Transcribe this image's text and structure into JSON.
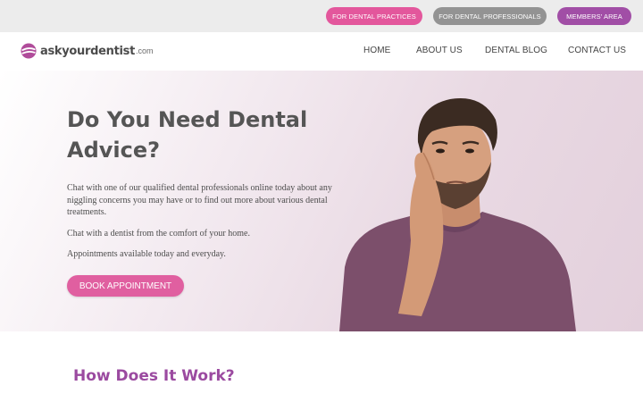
{
  "topbar": {
    "buttons": [
      {
        "label": "FOR DENTAL PRACTICES",
        "color": "#e3579c"
      },
      {
        "label": "FOR DENTAL PROFESSIONALS",
        "color": "#939393"
      },
      {
        "label": "MEMBERS' AREA",
        "color": "#a14ea6"
      }
    ]
  },
  "header": {
    "logo": {
      "name": "askyourdentist",
      "suffix": ".com"
    },
    "nav": [
      {
        "label": "HOME"
      },
      {
        "label": "ABOUT US"
      },
      {
        "label": "DENTAL BLOG"
      },
      {
        "label": "CONTACT US"
      }
    ]
  },
  "hero": {
    "title": "Do You Need Dental Advice?",
    "paragraphs": [
      "Chat with one of our qualified dental professionals online today about any niggling concerns you may have or to find out more about various dental treatments.",
      "Chat with a dentist from the comfort of your home.",
      "Appointments available today and everyday."
    ],
    "cta_label": "BOOK APPOINTMENT"
  },
  "how_it_works": {
    "title": "How Does It Work?"
  },
  "colors": {
    "accent_pink": "#e05fa0",
    "accent_purple": "#9b4aa0",
    "gray_button": "#939393"
  }
}
